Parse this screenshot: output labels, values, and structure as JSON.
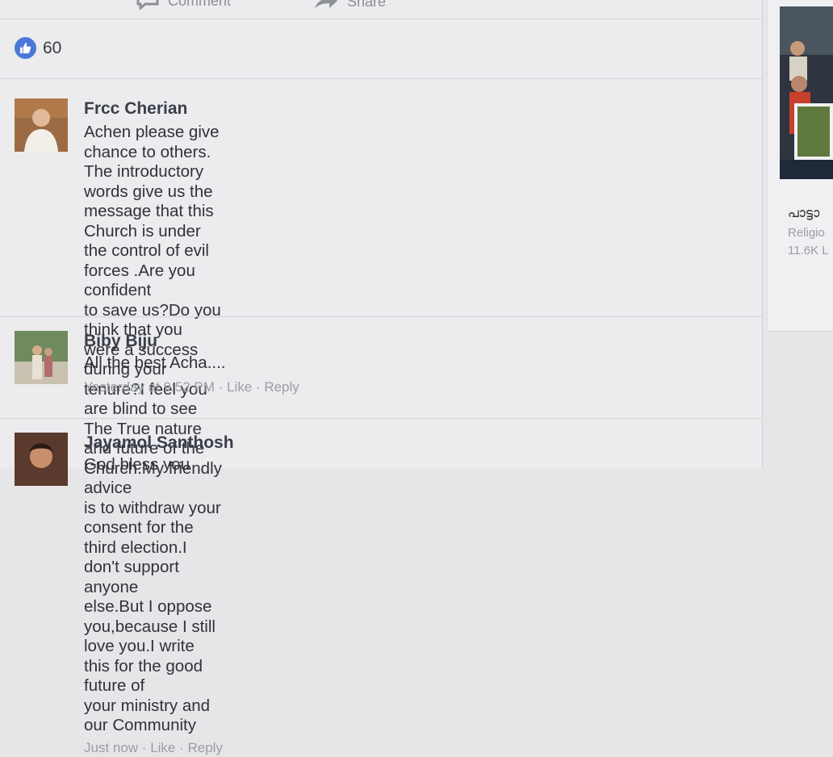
{
  "actions": {
    "comment_label": "Comment",
    "share_label": "Share"
  },
  "reactions": {
    "count": "60"
  },
  "comments": [
    {
      "author": "Frcc Cherian",
      "text_lines": [
        "Achen please give chance to others. The introductory words give us the",
        "message that this Church is under the control of evil forces .Are you confident",
        "to save us?Do you think that you were a success during your tenure?I feel you",
        "are blind to see The True nature and future of the Church.My friendly advice",
        "is to withdraw your consent for the third election.I don't support anyone",
        "else.But I oppose you,because I still love you.I write this for the good future of",
        "your ministry and our Community"
      ],
      "time": "Just now",
      "like": "Like",
      "reply": "Reply"
    },
    {
      "author": "Biby Biju",
      "text_lines": [
        "All the best Acha...."
      ],
      "time": "Yesterday at 9:52 PM",
      "like": "Like",
      "reply": "Reply"
    },
    {
      "author": "Jayamol Santhosh",
      "text_lines": [
        "God bless  you"
      ]
    }
  ],
  "sidebar": {
    "page_name": "പാട്ടാ",
    "category": "Religio",
    "likes": "11.6K L"
  },
  "colors": {
    "like_blue": "#4a78d8",
    "meta_gray": "#9a9da4",
    "author": "#3a3e4a"
  }
}
